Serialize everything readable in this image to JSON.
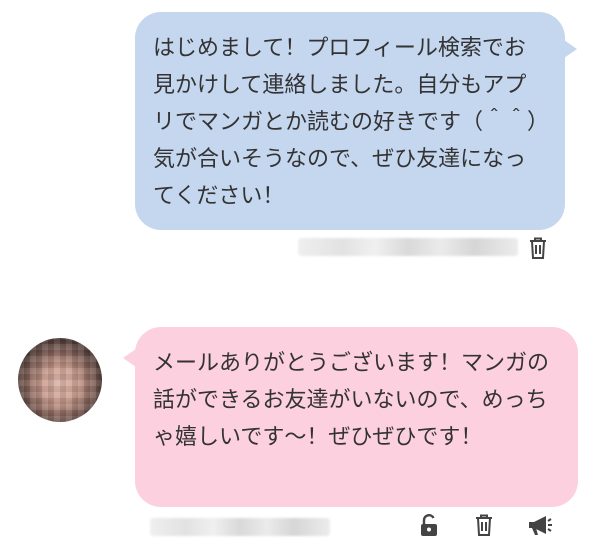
{
  "messages": [
    {
      "direction": "sent",
      "text": "はじめまして！プロフィール検索でお見かけして連絡しました。自分もアプリでマンガとか読むの好きです（＾＾）気が合いそうなので、ぜひ友達になってください！",
      "actions": [
        "trash-icon"
      ]
    },
    {
      "direction": "received",
      "text": "メールありがとうございます！マンガの話ができるお友達がいないので、めっちゃ嬉しいです〜！ぜひぜひです！",
      "actions": [
        "unlock-icon",
        "trash-icon",
        "megaphone-icon"
      ]
    }
  ],
  "colors": {
    "sent_bubble": "#c5d6ef",
    "received_bubble": "#fcd0de",
    "text": "#333333",
    "icon": "#444444"
  }
}
